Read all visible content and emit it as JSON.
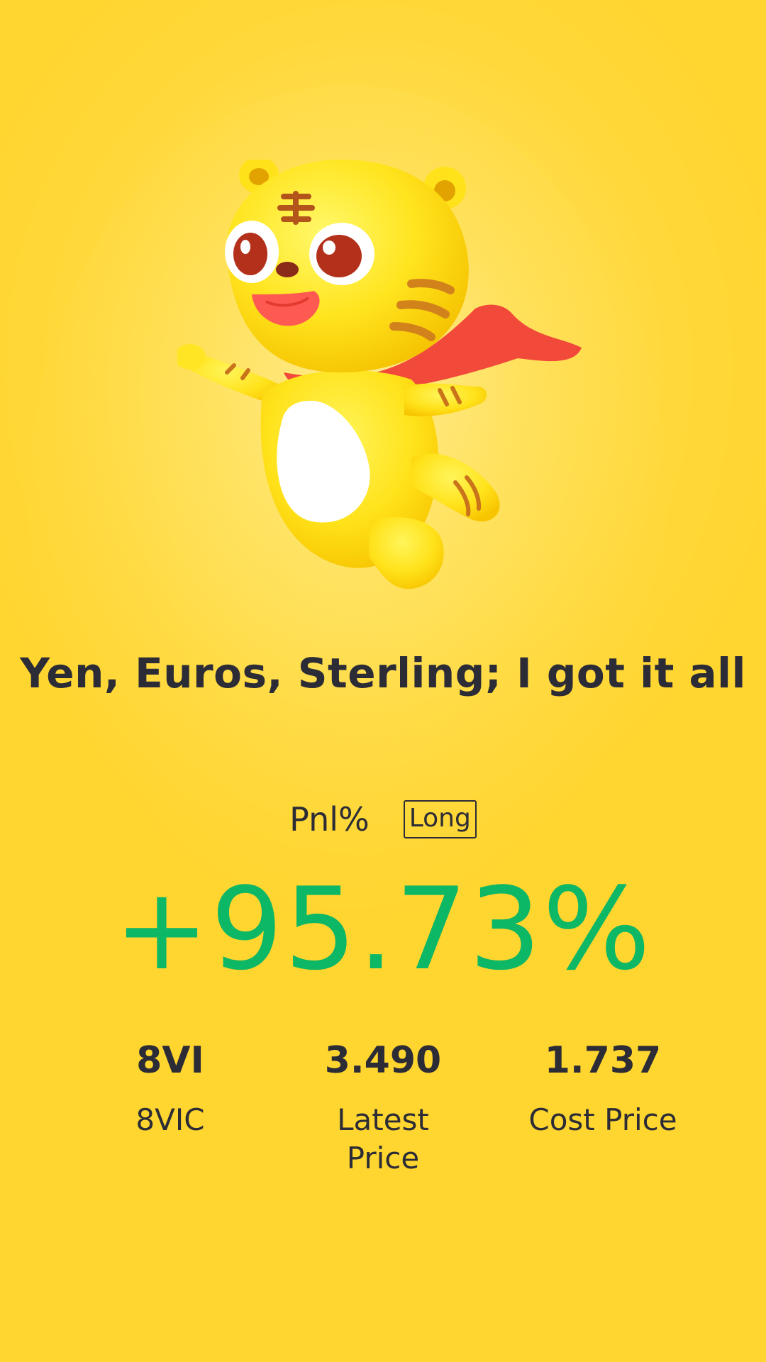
{
  "share_card": {
    "mascot": {
      "icon": "tiger-mascot-icon",
      "cape_color": "#f24a3a"
    },
    "slogan": "Yen, Euros, Sterling; I got it all",
    "pnl": {
      "label": "Pnl%",
      "direction": "Long",
      "value": "+95.73%",
      "value_color": "#0cb765"
    },
    "stats": [
      {
        "value": "8VI",
        "label": "8VIC"
      },
      {
        "value": "3.490",
        "label": "Latest Price"
      },
      {
        "value": "1.737",
        "label": "Cost Price"
      }
    ],
    "colors": {
      "background": "#ffd83a",
      "text": "#2c2c36"
    }
  }
}
